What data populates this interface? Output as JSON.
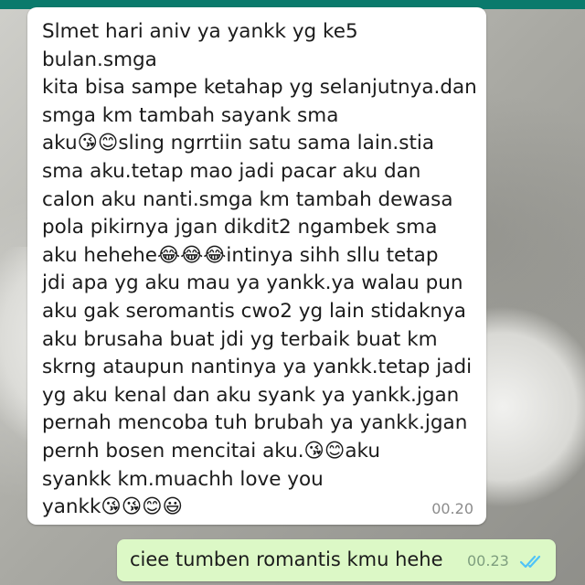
{
  "chat": {
    "incoming": {
      "text": "Slmet hari aniv ya yankk yg ke5 bulan.smga\nkita bisa sampe ketahap yg selanjutnya.dan\nsmga km tambah sayank sma\naku😘😊sling ngrrtiin satu sama lain.stia\nsma aku.tetap mao jadi pacar aku dan\ncalon aku nanti.smga km tambah dewasa\npola pikirnya jgan dikdit2 ngambek sma\naku hehehe😂😂😂intinya sihh sllu tetap\njdi apa yg aku mau ya yankk.ya walau pun\naku gak seromantis cwo2 yg lain stidaknya\naku brusaha buat jdi yg terbaik buat km\nskrng ataupun nantinya ya yankk.tetap jadi\nyg aku kenal dan aku syank ya yankk.jgan\npernah mencoba tuh brubah ya yankk.jgan\npernh bosen mencitai aku.😘😊aku\nsyankk km.muachh love you\nyankk😘😘😊😃",
      "time": "00.20"
    },
    "outgoing": {
      "text": "ciee tumben romantis kmu hehe",
      "time": "00.23",
      "status_icon": "double-check-read-icon",
      "status_color": "#4fc3f7"
    }
  },
  "colors": {
    "incoming_bubble": "#ffffff",
    "outgoing_bubble": "#dcf8c6",
    "header": "#0a7a6c"
  }
}
